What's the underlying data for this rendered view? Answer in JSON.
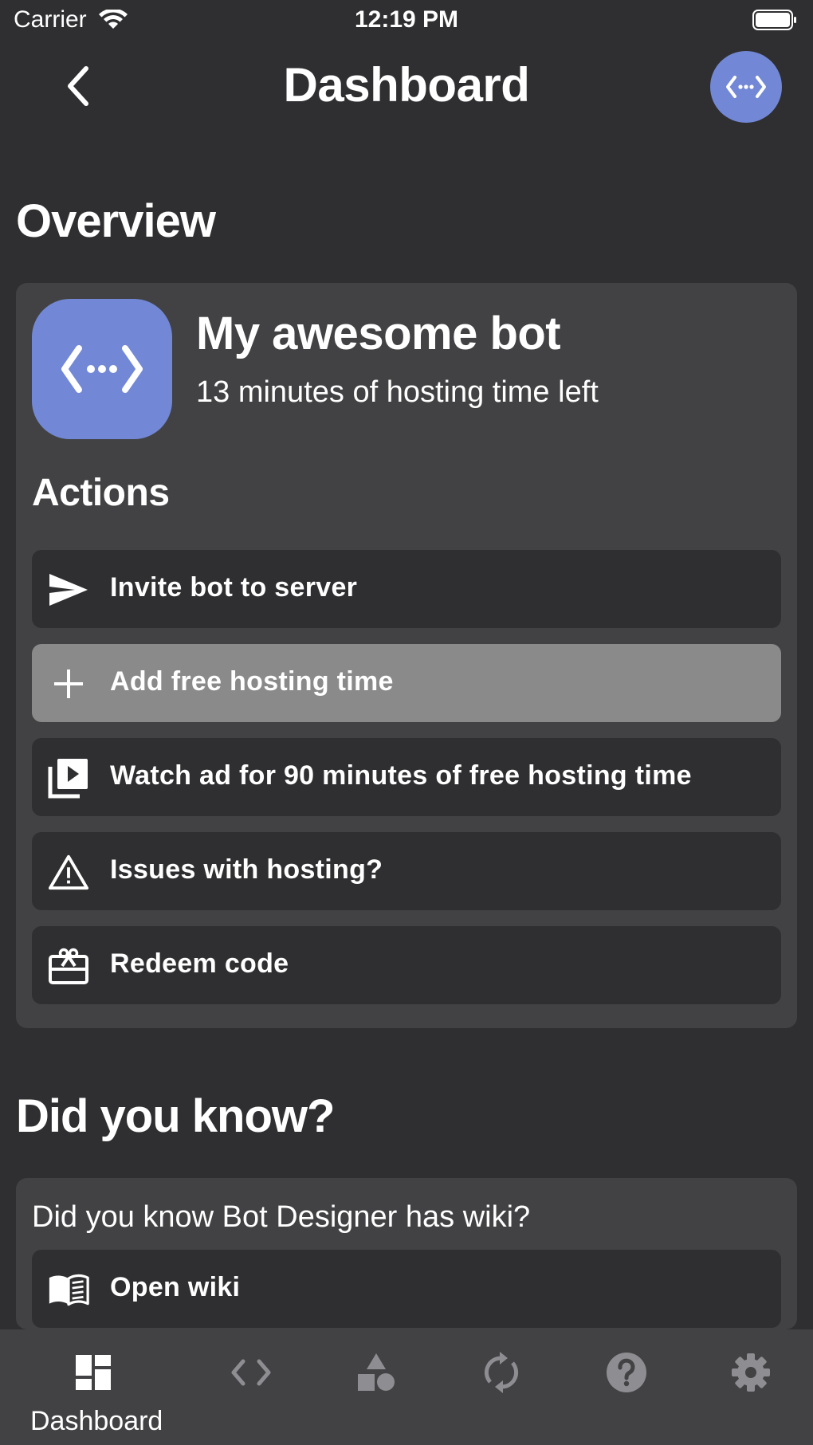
{
  "status_bar": {
    "carrier": "Carrier",
    "time": "12:19 PM"
  },
  "nav": {
    "title": "Dashboard"
  },
  "overview": {
    "title": "Overview",
    "bot_name": "My awesome bot",
    "hosting_time": "13 minutes of hosting time left",
    "actions_title": "Actions",
    "actions": [
      {
        "label": "Invite bot to server",
        "icon": "send-icon"
      },
      {
        "label": "Add free hosting time",
        "icon": "plus-icon"
      },
      {
        "label": "Watch ad for 90 minutes of free hosting time",
        "icon": "video-library-icon"
      },
      {
        "label": "Issues with hosting?",
        "icon": "warning-icon"
      },
      {
        "label": "Redeem code",
        "icon": "gift-card-icon"
      }
    ]
  },
  "did_you_know": {
    "title": "Did you know?",
    "question": "Did you know Bot Designer has wiki?",
    "button_label": "Open wiki"
  },
  "tab_bar": {
    "tabs": [
      {
        "label": "Dashboard",
        "icon": "dashboard-icon",
        "active": true
      },
      {
        "label": "",
        "icon": "code-icon",
        "active": false
      },
      {
        "label": "",
        "icon": "shapes-icon",
        "active": false
      },
      {
        "label": "",
        "icon": "sync-icon",
        "active": false
      },
      {
        "label": "",
        "icon": "help-icon",
        "active": false
      },
      {
        "label": "",
        "icon": "settings-icon",
        "active": false
      }
    ]
  },
  "colors": {
    "background": "#2f2f31",
    "card": "#424244",
    "accent": "#7288d6",
    "highlight": "#8a8a8a",
    "inactive_icon": "#8e8e92"
  }
}
